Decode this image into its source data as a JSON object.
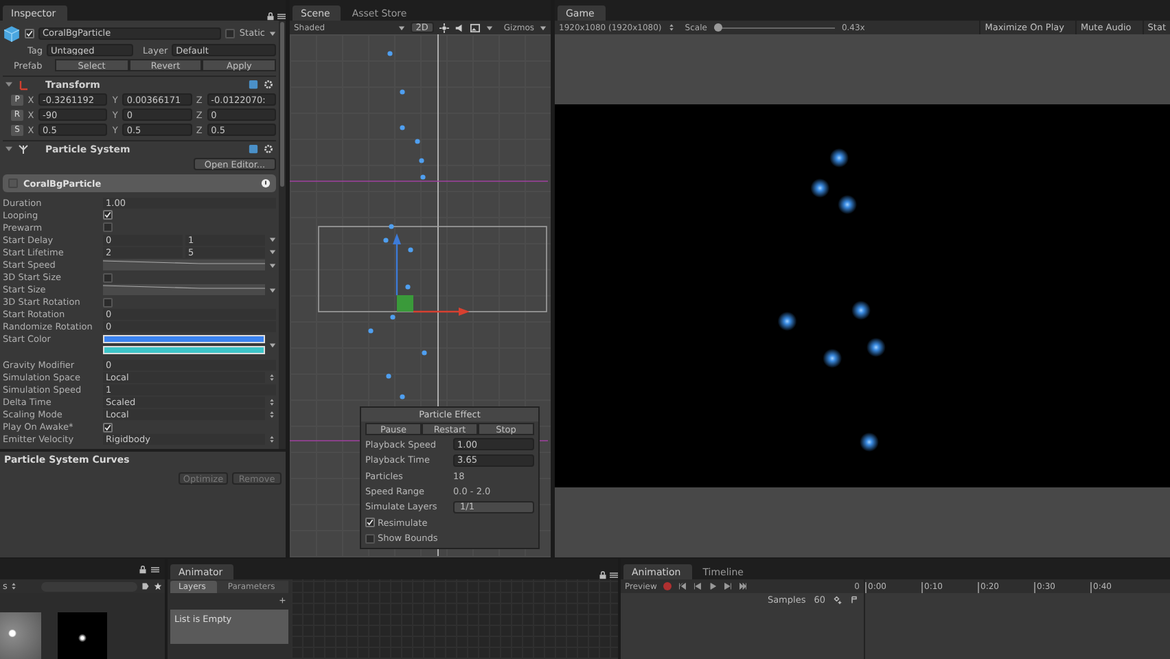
{
  "inspector": {
    "tab": {
      "label": "Inspector",
      "selected": true
    },
    "object_name": "CoralBgParticle",
    "active": true,
    "static": {
      "label": "Static",
      "checked": false
    },
    "tag_label": "Tag",
    "tag": "Untagged",
    "layer_label": "Layer",
    "layer": "Default",
    "prefab_label": "Prefab",
    "prefab_buttons": [
      "Select",
      "Revert",
      "Apply"
    ],
    "transform": {
      "title": "Transform",
      "expanded": true,
      "rows": [
        {
          "label": "P",
          "fields": [
            {
              "axis": "X",
              "value": "-0.3261192"
            },
            {
              "axis": "Y",
              "value": "0.00366171"
            },
            {
              "axis": "Z",
              "value": "-0.0122070:"
            }
          ]
        },
        {
          "label": "R",
          "fields": [
            {
              "axis": "X",
              "value": "-90"
            },
            {
              "axis": "Y",
              "value": "0"
            },
            {
              "axis": "Z",
              "value": "0"
            }
          ]
        },
        {
          "label": "S",
          "fields": [
            {
              "axis": "X",
              "value": "0.5"
            },
            {
              "axis": "Y",
              "value": "0.5"
            },
            {
              "axis": "Z",
              "value": "0.5"
            }
          ]
        }
      ]
    },
    "particle_system": {
      "title": "Particle System",
      "expanded": true,
      "open_editor": "Open Editor...",
      "module": "CoralBgParticle",
      "properties": [
        {
          "label": "Duration",
          "kind": "text",
          "value": "1.00"
        },
        {
          "label": "Looping",
          "kind": "check",
          "checked": true
        },
        {
          "label": "Prewarm",
          "kind": "check",
          "checked": false
        },
        {
          "label": "Start Delay",
          "kind": "pair",
          "values": [
            "0",
            "1"
          ]
        },
        {
          "label": "Start Lifetime",
          "kind": "pair",
          "values": [
            "2",
            "5"
          ]
        },
        {
          "label": "Start Speed",
          "kind": "curve"
        },
        {
          "label": "3D Start Size",
          "kind": "check",
          "checked": false
        },
        {
          "label": "Start Size",
          "kind": "curve"
        },
        {
          "label": "3D Start Rotation",
          "kind": "check",
          "checked": false
        },
        {
          "label": "Start Rotation",
          "kind": "text",
          "value": "0"
        },
        {
          "label": "Randomize Rotation",
          "kind": "text",
          "value": "0"
        },
        {
          "label": "Start Color",
          "kind": "gradient",
          "stops": [
            {
              "color": "#3a82f0"
            },
            {
              "color": "#3cc4c8"
            }
          ]
        },
        {
          "label": "Gravity Modifier",
          "kind": "text",
          "value": "0"
        },
        {
          "label": "Simulation Space",
          "kind": "dropdown",
          "value": "Local"
        },
        {
          "label": "Simulation Speed",
          "kind": "text",
          "value": "1"
        },
        {
          "label": "Delta Time",
          "kind": "dropdown",
          "value": "Scaled"
        },
        {
          "label": "Scaling Mode",
          "kind": "dropdown",
          "value": "Local"
        },
        {
          "label": "Play On Awake*",
          "kind": "check",
          "checked": true
        },
        {
          "label": "Emitter Velocity",
          "kind": "dropdown",
          "value": "Rigidbody"
        }
      ]
    }
  },
  "curves_panel": {
    "title": "Particle System Curves",
    "buttons": [
      "Optimize",
      "Remove"
    ]
  },
  "scene": {
    "tabs": [
      {
        "label": "Scene",
        "selected": true
      },
      {
        "label": "Asset Store",
        "selected": false
      }
    ],
    "shading": "Shaded",
    "mode_2d": "2D",
    "gizmos": "Gizmos"
  },
  "particle_effect": {
    "title": "Particle Effect",
    "buttons": [
      "Pause",
      "Restart",
      "Stop"
    ],
    "rows": [
      {
        "label": "Playback Speed",
        "kind": "field",
        "value": "1.00"
      },
      {
        "label": "Playback Time",
        "kind": "field",
        "value": "3.65"
      },
      {
        "label": "Particles",
        "kind": "text",
        "value": "18"
      },
      {
        "label": "Speed Range",
        "kind": "text",
        "value": "0.0 - 2.0"
      },
      {
        "label": "Simulate Layers",
        "kind": "dropdown",
        "value": "1/1"
      }
    ],
    "checks": [
      {
        "label": "Resimulate",
        "checked": true
      },
      {
        "label": "Show Bounds",
        "checked": false
      }
    ]
  },
  "game": {
    "tab": {
      "label": "Game",
      "selected": true
    },
    "resolution": "1920x1080 (1920x1080)",
    "scale_label": "Scale",
    "scale": {
      "level": 0.0
    },
    "scale_value": "0.43x",
    "toggles": [
      {
        "label": "Maximize On Play",
        "on": false
      },
      {
        "label": "Mute Audio",
        "on": false
      },
      {
        "label": "Stat",
        "on": false
      }
    ]
  },
  "project": {
    "tab_fragment": "s"
  },
  "animator": {
    "tab": {
      "label": "Animator",
      "selected": true
    },
    "tabs": [
      {
        "label": "Layers",
        "selected": true
      },
      {
        "label": "Parameters",
        "selected": false
      }
    ],
    "add": "+",
    "empty": "List is Empty"
  },
  "animation": {
    "tabs": [
      {
        "label": "Animation",
        "selected": true
      },
      {
        "label": "Timeline",
        "selected": false
      }
    ],
    "preview": "Preview",
    "frame": "0",
    "ruler": [
      "0:00",
      "0:10",
      "0:20",
      "0:30",
      "0:40"
    ],
    "samples_label": "Samples",
    "samples": "60"
  }
}
